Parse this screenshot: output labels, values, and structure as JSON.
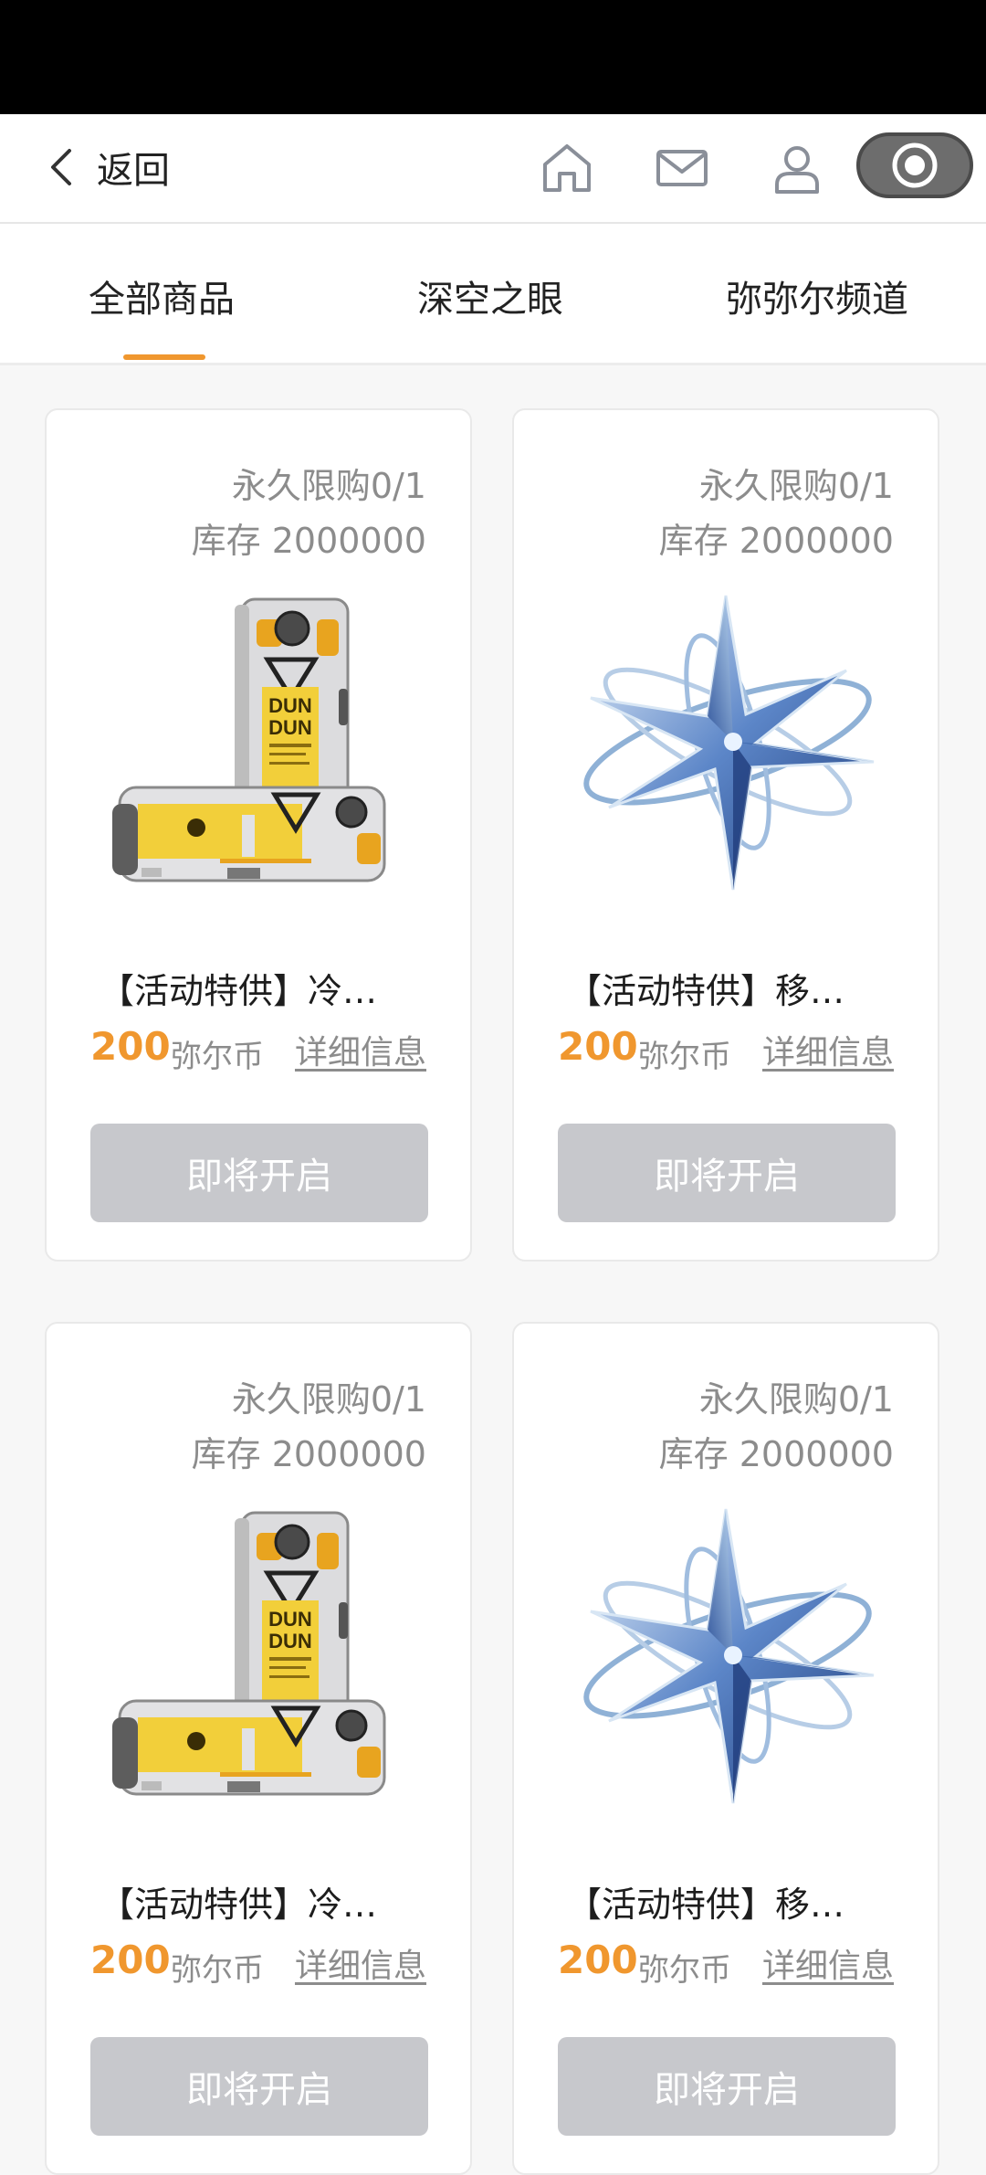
{
  "header": {
    "back_label": "返回",
    "icons": [
      "home-icon",
      "mail-icon",
      "user-icon",
      "record-icon"
    ]
  },
  "tabs": [
    {
      "label": "全部商品",
      "active": true
    },
    {
      "label": "深空之眼",
      "active": false
    },
    {
      "label": "弥弥尔频道",
      "active": false
    }
  ],
  "accent_color": "#f0972e",
  "products": [
    {
      "limit": "永久限购0/1",
      "stock": "库存 2000000",
      "image": "dundun-device-image",
      "title": "【活动特供】冷…",
      "price": "200",
      "currency": "弥尔币",
      "details": "详细信息",
      "button": "即将开启"
    },
    {
      "limit": "永久限购0/1",
      "stock": "库存 2000000",
      "image": "crystal-star-image",
      "title": "【活动特供】移…",
      "price": "200",
      "currency": "弥尔币",
      "details": "详细信息",
      "button": "即将开启"
    },
    {
      "limit": "永久限购0/1",
      "stock": "库存 2000000",
      "image": "dundun-device-image",
      "title": "【活动特供】冷…",
      "price": "200",
      "currency": "弥尔币",
      "details": "详细信息",
      "button": "即将开启"
    },
    {
      "limit": "永久限购0/1",
      "stock": "库存 2000000",
      "image": "crystal-star-image",
      "title": "【活动特供】移…",
      "price": "200",
      "currency": "弥尔币",
      "details": "详细信息",
      "button": "即将开启"
    }
  ]
}
